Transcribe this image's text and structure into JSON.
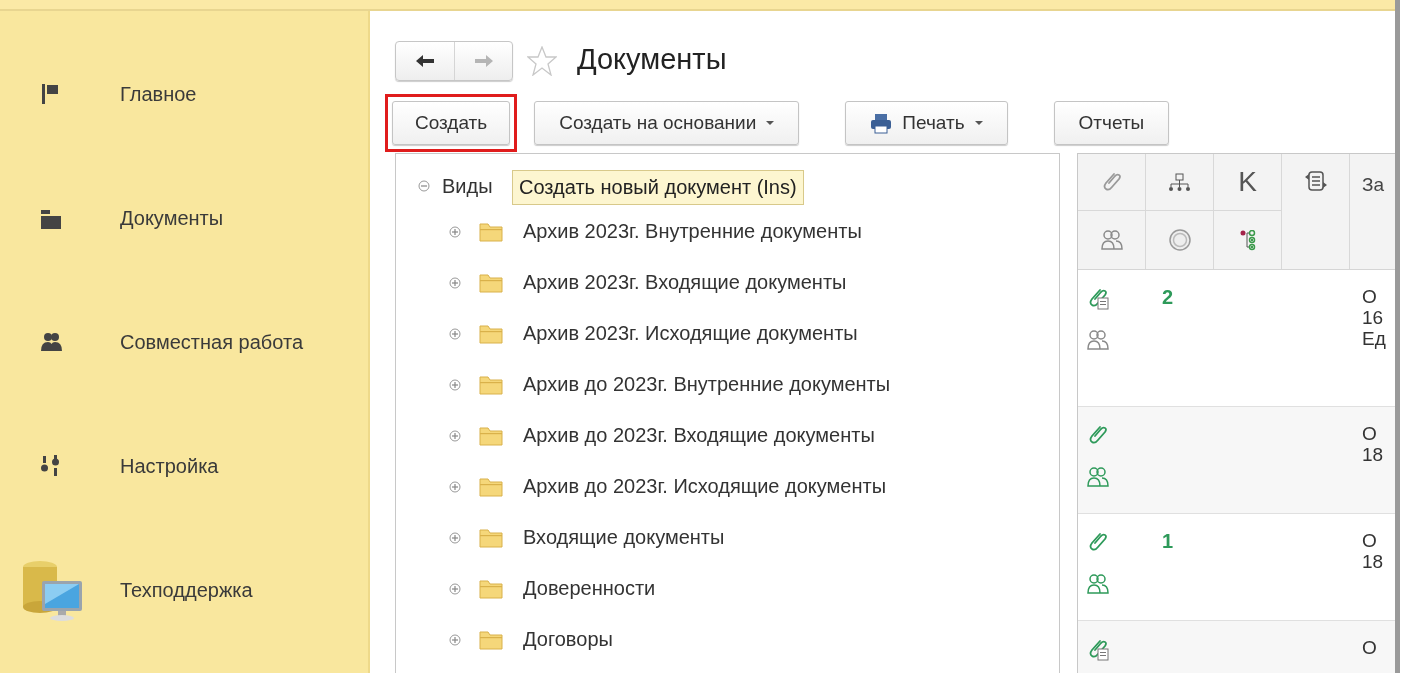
{
  "sidebar": {
    "items": [
      {
        "label": "Главное",
        "kind": "flag"
      },
      {
        "label": "Документы",
        "kind": "folder"
      },
      {
        "label": "Совместная работа",
        "kind": "people"
      },
      {
        "label": "Настройка",
        "kind": "sliders"
      },
      {
        "label": "Техподдержка",
        "kind": "support"
      }
    ]
  },
  "header": {
    "title": "Документы",
    "back_disabled": false,
    "forward_disabled": true,
    "favorite": false
  },
  "toolbar": {
    "buttons": [
      {
        "label": "Создать",
        "kind": "plain",
        "highlighted": true
      },
      {
        "label": "Создать на основании",
        "kind": "dropdown",
        "highlighted": false
      },
      {
        "label": "Печать",
        "kind": "print",
        "highlighted": false
      },
      {
        "label": "Отчеты",
        "kind": "plain",
        "highlighted": false
      }
    ]
  },
  "tooltip": "Создать новый документ (Ins)",
  "tree": {
    "label": "Виды",
    "expanded": true,
    "children": [
      {
        "label": "Архив 2023г. Внутренние документы",
        "expanded": false
      },
      {
        "label": "Архив 2023г. Входящие документы",
        "expanded": false
      },
      {
        "label": "Архив 2023г. Исходящие документы",
        "expanded": false
      },
      {
        "label": "Архив до 2023г. Внутренние документы",
        "expanded": false
      },
      {
        "label": "Архив до 2023г. Входящие документы",
        "expanded": false
      },
      {
        "label": "Архив до 2023г. Исходящие документы",
        "expanded": false
      },
      {
        "label": "Входящие документы",
        "expanded": false
      },
      {
        "label": "Доверенности",
        "expanded": false
      },
      {
        "label": "Договоры",
        "expanded": false
      }
    ]
  },
  "table": {
    "header": {
      "column_3": "K",
      "column_5": "За"
    },
    "rows": [
      {
        "kind": "file",
        "participants_active": false,
        "count": "2",
        "column_5": [
          "О",
          "16",
          "Ед"
        ]
      },
      {
        "kind": "plain",
        "participants_active": true,
        "column_5": [
          "О",
          "18"
        ]
      },
      {
        "kind": "plain",
        "participants_active": true,
        "count": "1",
        "column_5": [
          "О",
          "18"
        ]
      },
      {
        "kind": "file",
        "column_5": [
          "О"
        ]
      }
    ]
  }
}
